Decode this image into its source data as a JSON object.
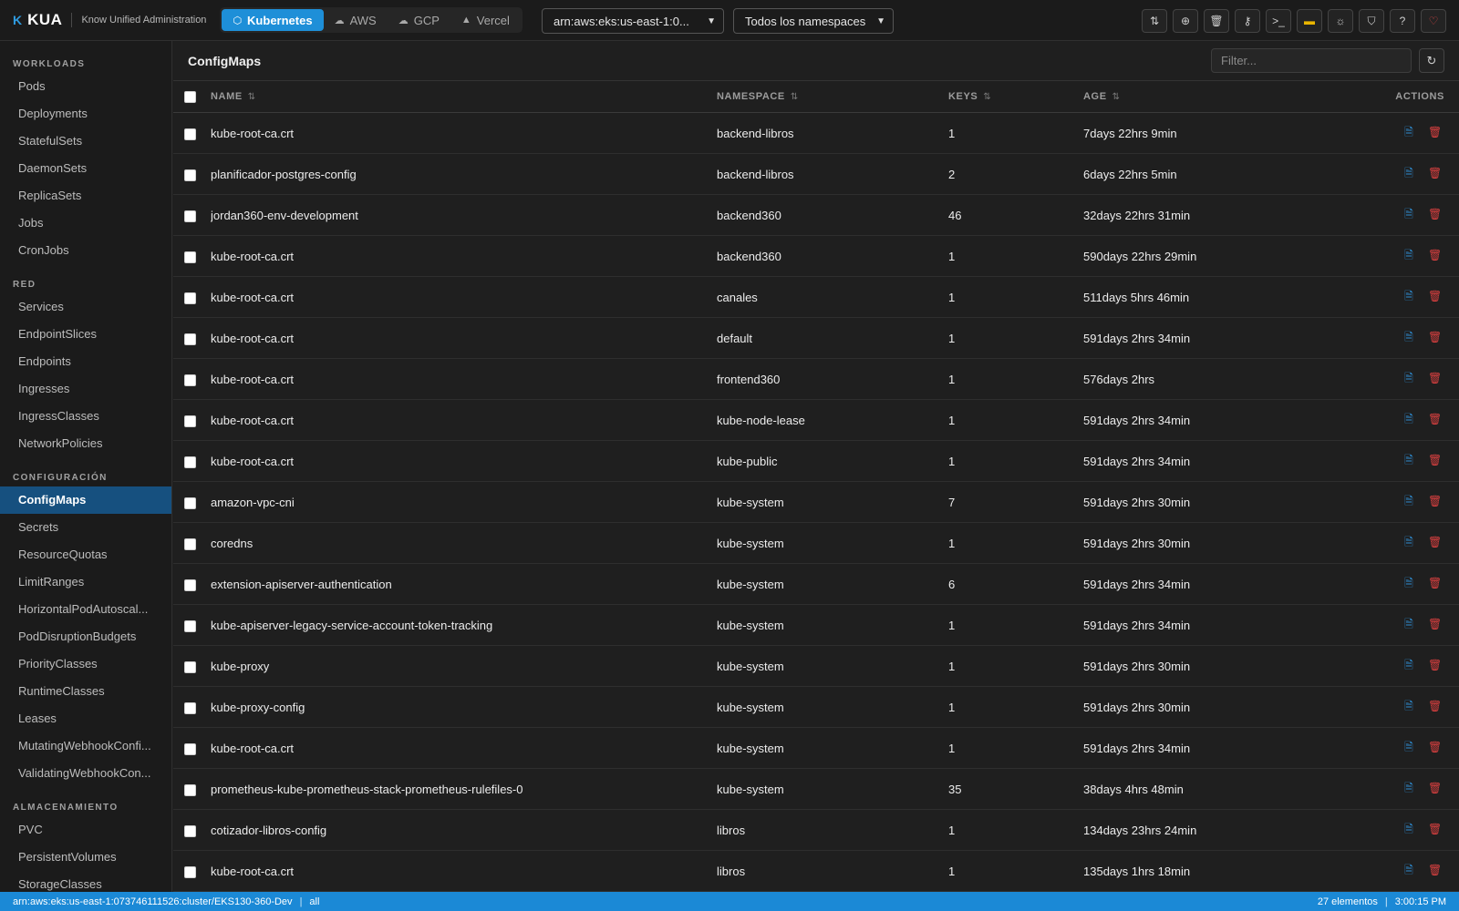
{
  "app": {
    "logo_mark": "K",
    "name": "KUA",
    "subtitle": "Know Unified Administration"
  },
  "providers": [
    {
      "label": "Kubernetes",
      "icon": "⬡",
      "active": true
    },
    {
      "label": "AWS",
      "icon": "☁",
      "active": false
    },
    {
      "label": "GCP",
      "icon": "☁",
      "active": false
    },
    {
      "label": "Vercel",
      "icon": "▲",
      "active": false
    }
  ],
  "cluster_select": {
    "value": "arn:aws:eks:us-east-1:0..."
  },
  "namespace_select": {
    "value": "Todos los namespaces"
  },
  "toolbar_icons": [
    {
      "name": "compare-icon",
      "glyph": "⇅"
    },
    {
      "name": "add-circle-icon",
      "glyph": "⊕"
    },
    {
      "name": "trash-icon",
      "glyph": "🗑"
    },
    {
      "name": "key-icon",
      "glyph": "⚷"
    },
    {
      "name": "terminal-icon",
      "glyph": ">_"
    },
    {
      "name": "spain-flag-icon",
      "glyph": "▬"
    },
    {
      "name": "sun-icon",
      "glyph": "☼"
    },
    {
      "name": "shield-icon",
      "glyph": "⛉"
    },
    {
      "name": "help-icon",
      "glyph": "?"
    },
    {
      "name": "heart-icon",
      "glyph": "♡"
    }
  ],
  "sidebar": {
    "sections": [
      {
        "title": "WORKLOADS",
        "items": [
          "Pods",
          "Deployments",
          "StatefulSets",
          "DaemonSets",
          "ReplicaSets",
          "Jobs",
          "CronJobs"
        ]
      },
      {
        "title": "RED",
        "items": [
          "Services",
          "EndpointSlices",
          "Endpoints",
          "Ingresses",
          "IngressClasses",
          "NetworkPolicies"
        ]
      },
      {
        "title": "CONFIGURACIÓN",
        "items": [
          "ConfigMaps",
          "Secrets",
          "ResourceQuotas",
          "LimitRanges",
          "HorizontalPodAutoscal...",
          "PodDisruptionBudgets",
          "PriorityClasses",
          "RuntimeClasses",
          "Leases",
          "MutatingWebhookConfi...",
          "ValidatingWebhookCon..."
        ]
      },
      {
        "title": "ALMACENAMIENTO",
        "items": [
          "PVC",
          "PersistentVolumes",
          "StorageClasses"
        ]
      }
    ],
    "active_item": "ConfigMaps"
  },
  "main": {
    "title": "ConfigMaps",
    "filter_placeholder": "Filter...",
    "columns": {
      "name": "NAME",
      "namespace": "NAMESPACE",
      "keys": "KEYS",
      "age": "AGE",
      "actions": "ACTIONS"
    },
    "sort_glyph": "⇅",
    "rows": [
      {
        "name": "kube-root-ca.crt",
        "namespace": "backend-libros",
        "keys": "1",
        "age": "7days 22hrs 9min"
      },
      {
        "name": "planificador-postgres-config",
        "namespace": "backend-libros",
        "keys": "2",
        "age": "6days 22hrs 5min"
      },
      {
        "name": "jordan360-env-development",
        "namespace": "backend360",
        "keys": "46",
        "age": "32days 22hrs 31min"
      },
      {
        "name": "kube-root-ca.crt",
        "namespace": "backend360",
        "keys": "1",
        "age": "590days 22hrs 29min"
      },
      {
        "name": "kube-root-ca.crt",
        "namespace": "canales",
        "keys": "1",
        "age": "511days 5hrs 46min"
      },
      {
        "name": "kube-root-ca.crt",
        "namespace": "default",
        "keys": "1",
        "age": "591days 2hrs 34min"
      },
      {
        "name": "kube-root-ca.crt",
        "namespace": "frontend360",
        "keys": "1",
        "age": "576days 2hrs"
      },
      {
        "name": "kube-root-ca.crt",
        "namespace": "kube-node-lease",
        "keys": "1",
        "age": "591days 2hrs 34min"
      },
      {
        "name": "kube-root-ca.crt",
        "namespace": "kube-public",
        "keys": "1",
        "age": "591days 2hrs 34min"
      },
      {
        "name": "amazon-vpc-cni",
        "namespace": "kube-system",
        "keys": "7",
        "age": "591days 2hrs 30min"
      },
      {
        "name": "coredns",
        "namespace": "kube-system",
        "keys": "1",
        "age": "591days 2hrs 30min"
      },
      {
        "name": "extension-apiserver-authentication",
        "namespace": "kube-system",
        "keys": "6",
        "age": "591days 2hrs 34min"
      },
      {
        "name": "kube-apiserver-legacy-service-account-token-tracking",
        "namespace": "kube-system",
        "keys": "1",
        "age": "591days 2hrs 34min"
      },
      {
        "name": "kube-proxy",
        "namespace": "kube-system",
        "keys": "1",
        "age": "591days 2hrs 30min"
      },
      {
        "name": "kube-proxy-config",
        "namespace": "kube-system",
        "keys": "1",
        "age": "591days 2hrs 30min"
      },
      {
        "name": "kube-root-ca.crt",
        "namespace": "kube-system",
        "keys": "1",
        "age": "591days 2hrs 34min"
      },
      {
        "name": "prometheus-kube-prometheus-stack-prometheus-rulefiles-0",
        "namespace": "kube-system",
        "keys": "35",
        "age": "38days 4hrs 48min"
      },
      {
        "name": "cotizador-libros-config",
        "namespace": "libros",
        "keys": "1",
        "age": "134days 23hrs 24min"
      },
      {
        "name": "kube-root-ca.crt",
        "namespace": "libros",
        "keys": "1",
        "age": "135days 1hrs 18min"
      }
    ]
  },
  "statusbar": {
    "cluster": "arn:aws:eks:us-east-1:073746111526:cluster/EKS130-360-Dev",
    "scope": "all",
    "count": "27 elementos",
    "time": "3:00:15 PM"
  },
  "colors": {
    "accent": "#1e8fd8",
    "active_nav": "#16507f",
    "statusbar": "#1b89d6",
    "delete": "#d94040",
    "background": "#1f1f1f"
  }
}
